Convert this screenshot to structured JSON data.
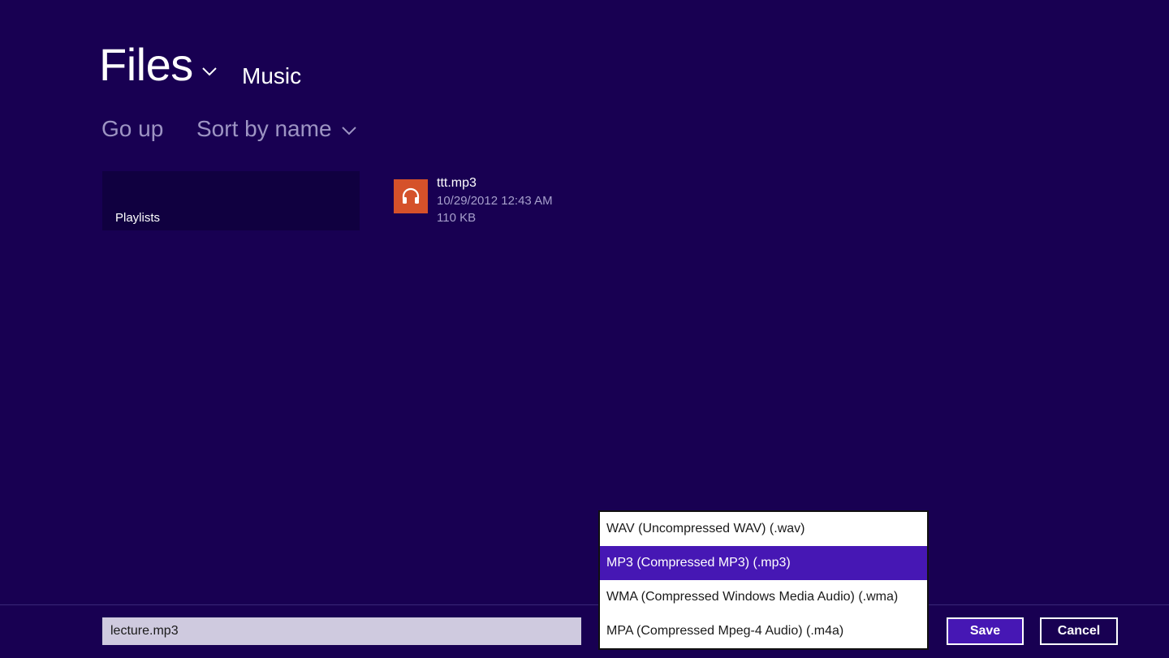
{
  "header": {
    "title": "Files",
    "location": "Music"
  },
  "commands": {
    "go_up": "Go up",
    "sort": "Sort by name"
  },
  "items": {
    "folder": {
      "label": "Playlists"
    },
    "file": {
      "name": "ttt.mp3",
      "date": "10/29/2012 12:43 AM",
      "size": "110 KB",
      "icon": "headphones-icon",
      "icon_color": "#d5512a"
    }
  },
  "save_bar": {
    "filename_value": "lecture.mp3",
    "file_types": [
      "WAV (Uncompressed WAV) (.wav)",
      "MP3 (Compressed MP3) (.mp3)",
      "WMA (Compressed Windows Media Audio) (.wma)",
      "MPA (Compressed Mpeg-4 Audio) (.m4a)"
    ],
    "selected_type": "MP3 (Compressed MP3) (.mp3)",
    "save_label": "Save",
    "cancel_label": "Cancel"
  },
  "colors": {
    "background": "#180052",
    "accent": "#4617b4"
  }
}
